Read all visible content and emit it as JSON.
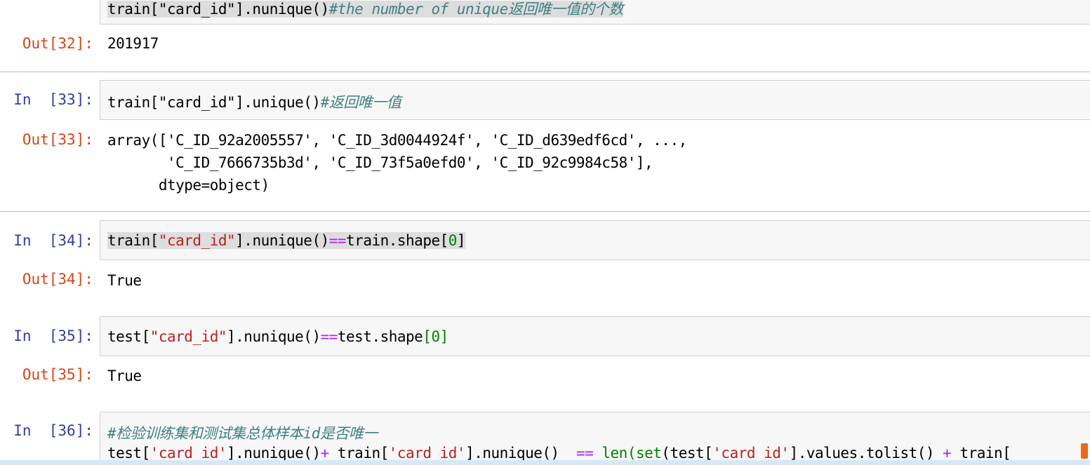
{
  "cells": {
    "c31": {
      "code_partial": "train[\"card_id\"].nunique()",
      "comment": "#the number of unique返回唯一值的个数"
    },
    "c32": {
      "out_prompt": "Out[32]:",
      "output": "201917"
    },
    "c33": {
      "in_prompt": "In  [33]:",
      "code": "train[\"card_id\"].unique()",
      "comment": "#返回唯一值",
      "out_prompt": "Out[33]:",
      "output_lines": [
        "array(['C_ID_92a2005557', 'C_ID_3d0044924f', 'C_ID_d639edf6cd', ...,",
        "       'C_ID_7666735b3d', 'C_ID_73f5a0efd0', 'C_ID_92c9984c58'],",
        "      dtype=object)"
      ]
    },
    "c34": {
      "in_prompt": "In  [34]:",
      "code_a": "train[",
      "code_str": "\"card_id\"",
      "code_b": "].nunique()",
      "code_op": "==",
      "code_c": "train.shape[",
      "code_num": "0",
      "code_d": "]",
      "out_prompt": "Out[34]:",
      "output": "True"
    },
    "c35": {
      "in_prompt": "In  [35]:",
      "code_a": "test[",
      "code_str": "\"card_id\"",
      "code_b": "].nunique()",
      "code_op": "==",
      "code_c": "test.shape",
      "code_num": "[0]",
      "out_prompt": "Out[35]:",
      "output": "True"
    },
    "c36": {
      "in_prompt": "In  [36]:",
      "comment": "#检验训练集和测试集总体样本id是否唯一",
      "line2": {
        "p1": "test[",
        "s1": "'card_id'",
        "p2": "].nunique()",
        "op1": "+",
        "p3": " train[",
        "s2": "'card_id'",
        "p4": "].nunique()  ",
        "op2": "==",
        "p5": " ",
        "b1": "len",
        "p6": "(",
        "b2": "set",
        "p7": "(test[",
        "s3": "'card_id'",
        "p8": "].values.tolist() ",
        "op3": "+",
        "p9": " train["
      }
    }
  }
}
